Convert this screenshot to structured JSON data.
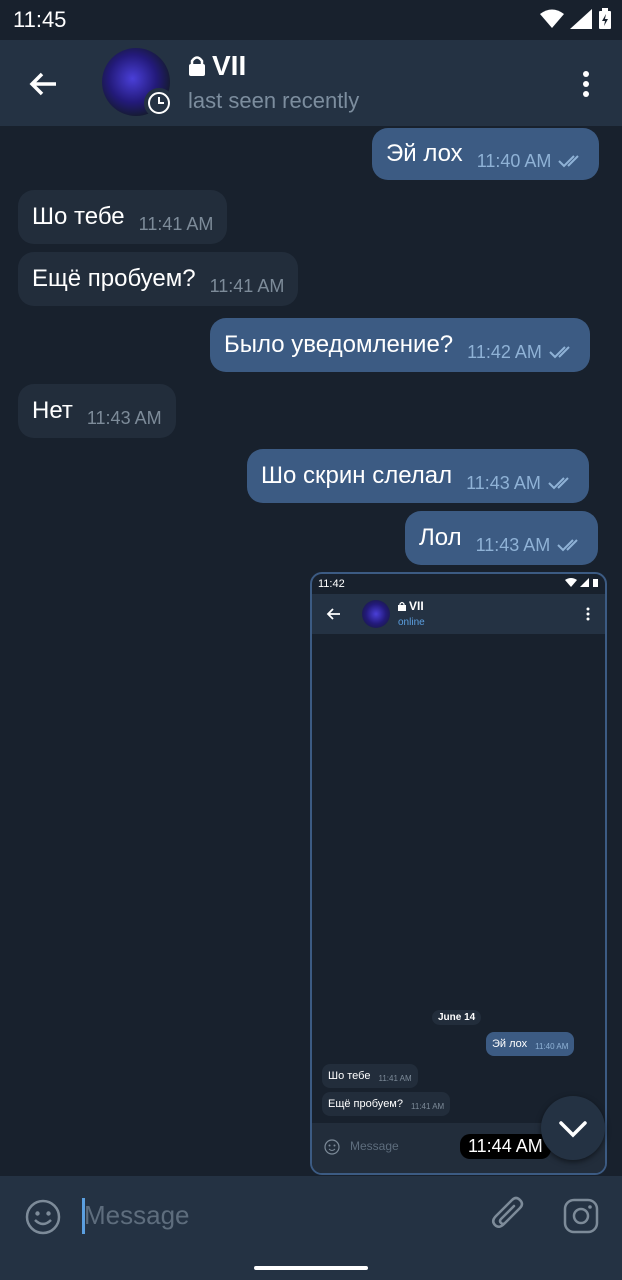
{
  "status": {
    "time": "11:45"
  },
  "header": {
    "name": "VII",
    "subtitle": "last seen recently"
  },
  "messages": [
    {
      "text": "Эй лох",
      "time": "11:40 AM",
      "dir": "out"
    },
    {
      "text": "Шо тебе",
      "time": "11:41 AM",
      "dir": "in"
    },
    {
      "text": "Ещё пробуем?",
      "time": "11:41 AM",
      "dir": "in"
    },
    {
      "text": "Было уведомление?",
      "time": "11:42 AM",
      "dir": "out"
    },
    {
      "text": "Нет",
      "time": "11:43 AM",
      "dir": "in"
    },
    {
      "text": "Шо скрин слелал",
      "time": "11:43 AM",
      "dir": "out"
    },
    {
      "text": "Лол",
      "time": "11:43 AM",
      "dir": "out"
    }
  ],
  "screenshot": {
    "status_time": "11:42",
    "name": "VII",
    "subtitle": "online",
    "date_chip": "June 14",
    "messages": [
      {
        "text": "Эй лох",
        "time": "11:40 AM"
      },
      {
        "text": "Шо тебе",
        "time": "11:41 AM"
      },
      {
        "text": "Ещё пробуем?",
        "time": "11:41 AM"
      }
    ],
    "input_placeholder": "Message",
    "time": "11:44 AM"
  },
  "input": {
    "placeholder": "Message"
  },
  "colors": {
    "background": "#18212d",
    "header": "#243243",
    "incoming": "#222d3b",
    "outgoing": "#3c5b83",
    "accent": "#5b9fe0"
  }
}
